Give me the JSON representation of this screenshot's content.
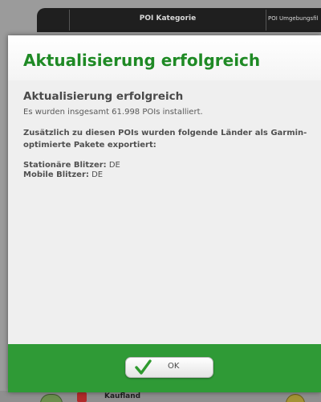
{
  "background": {
    "tabs": {
      "poi_category": "POI Kategorie",
      "poi_surroundings": "POI Umgebungsfil"
    },
    "bottom_item": "Kaufland"
  },
  "dialog": {
    "title": "Aktualisierung erfolgreich",
    "heading": "Aktualisierung erfolgreich",
    "summary": "Es wurden insgesamt 61.998 POIs installiert.",
    "export_note": "Zusätzlich zu diesen POIs wurden folgende Länder als Garmin-optimierte Pakete exportiert:",
    "stationary": {
      "label": "Stationäre Blitzer:",
      "value": "DE"
    },
    "mobile": {
      "label": "Mobile Blitzer:",
      "value": "DE"
    },
    "ok_button": {
      "label": "OK",
      "icon": "checkmark-icon"
    }
  },
  "colors": {
    "title_green": "#1f8a25",
    "footer_green": "#2f9a36",
    "checkmark_green": "#2e9a2e"
  }
}
